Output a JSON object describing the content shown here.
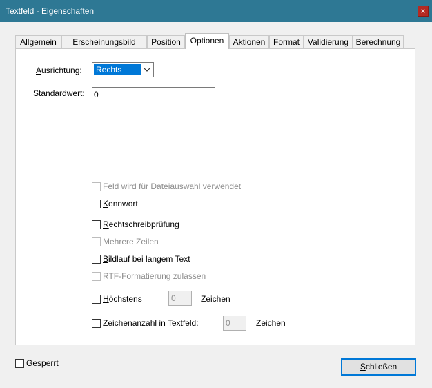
{
  "window": {
    "title": "Textfeld - Eigenschaften",
    "close_glyph": "x"
  },
  "tabs": [
    {
      "label": "Allgemein"
    },
    {
      "label": "Erscheinungsbild"
    },
    {
      "label": "Position"
    },
    {
      "label": "Optionen",
      "active": true
    },
    {
      "label": "Aktionen"
    },
    {
      "label": "Format"
    },
    {
      "label": "Validierung"
    },
    {
      "label": "Berechnung"
    }
  ],
  "alignment": {
    "label_pre": "",
    "label_u": "A",
    "label_post": "usrichtung:",
    "value": "Rechts"
  },
  "default_value": {
    "label_pre": "St",
    "label_u": "a",
    "label_post": "ndardwert:",
    "value": "0"
  },
  "options": {
    "file_select": {
      "label": "Feld wird für Dateiauswahl verwendet",
      "enabled": false,
      "checked": false
    },
    "password": {
      "label_u": "K",
      "label_rest": "ennwort",
      "enabled": true,
      "checked": false
    },
    "spellcheck": {
      "label_u": "R",
      "label_rest": "echtschreibprüfung",
      "enabled": true,
      "checked": false
    },
    "multiline": {
      "label": "Mehrere Zeilen",
      "enabled": false,
      "checked": false
    },
    "scroll_long": {
      "label_u": "B",
      "label_rest": "ildlauf bei langem Text",
      "enabled": true,
      "checked": false
    },
    "rtf": {
      "label": "RTF-Formatierung zulassen",
      "enabled": false,
      "checked": false
    },
    "max_chars": {
      "label_u": "H",
      "label_rest": "öchstens",
      "value": "0",
      "unit": "Zeichen",
      "checked": false
    },
    "comb": {
      "label_u": "Z",
      "label_rest": "eichenanzahl in Textfeld:",
      "value": "0",
      "unit": "Zeichen",
      "checked": false
    }
  },
  "footer": {
    "locked": {
      "label_u": "G",
      "label_rest": "esperrt",
      "checked": false
    },
    "close_button": {
      "label_u": "S",
      "label_rest": "chließen"
    }
  },
  "colors": {
    "titlebar": "#2e7894",
    "accent": "#0078d7",
    "close": "#b52a22"
  }
}
